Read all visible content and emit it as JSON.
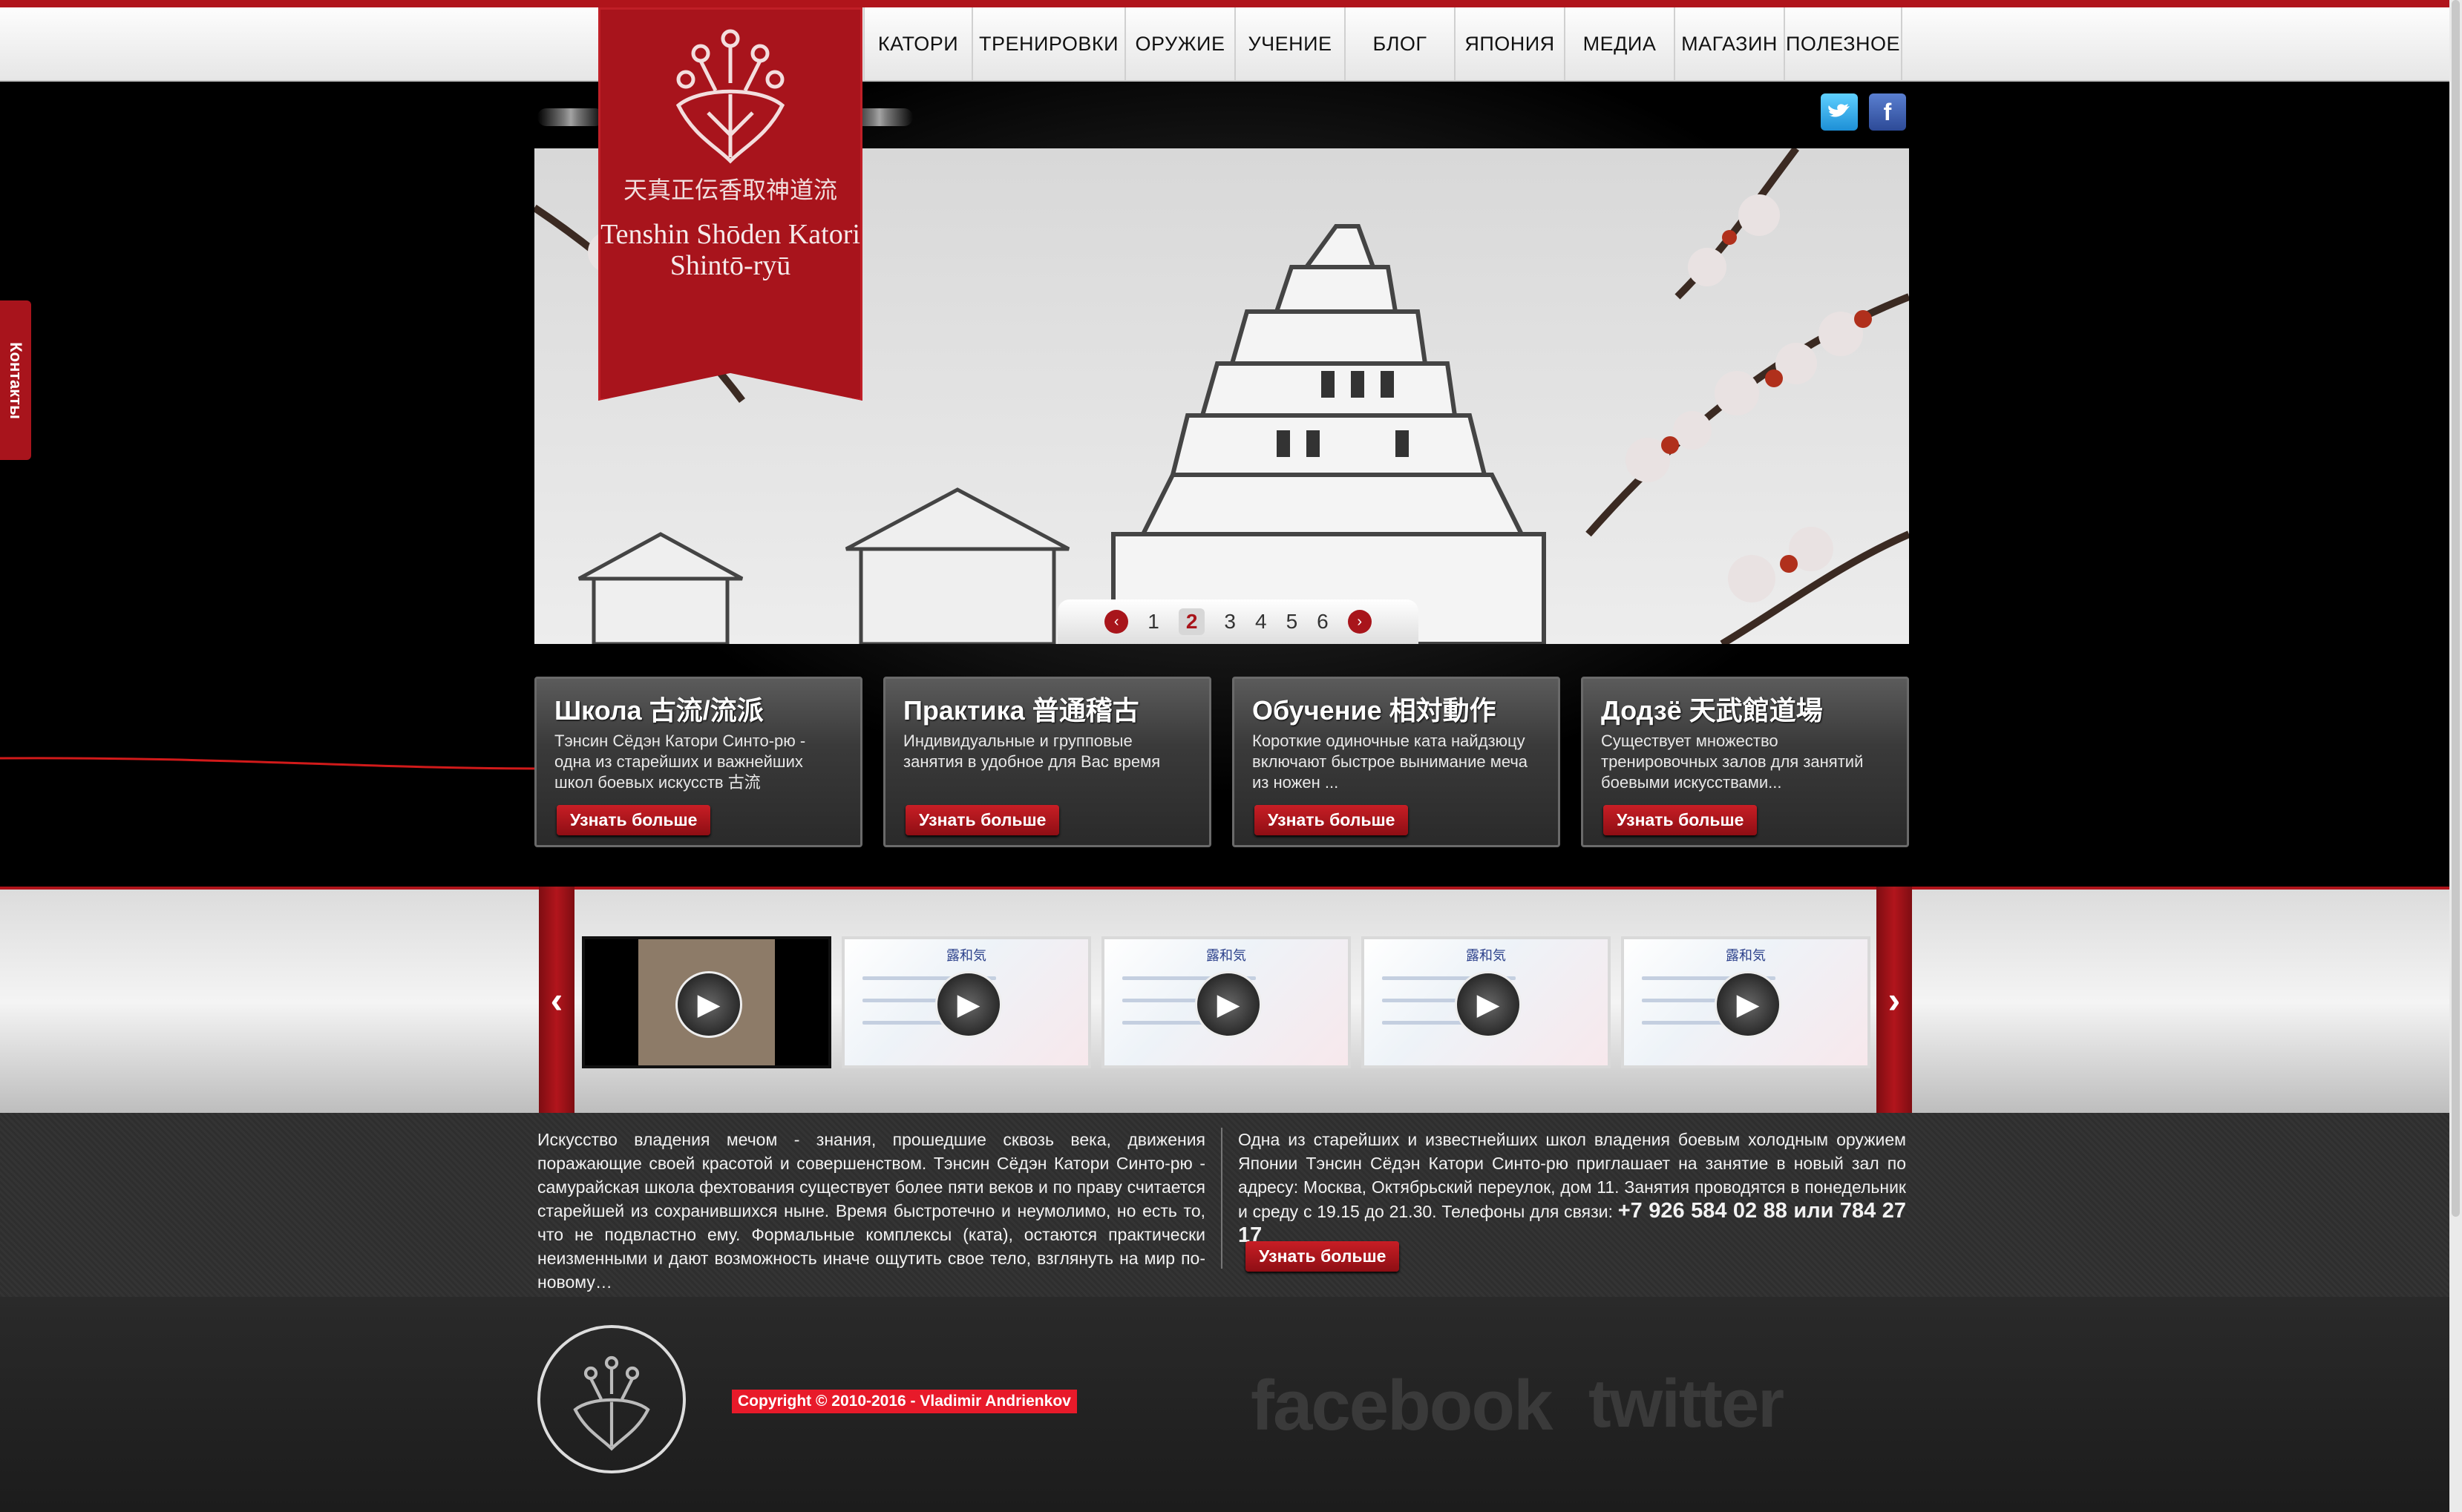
{
  "nav": {
    "items": [
      "КАТОРИ",
      "ТРЕНИРОВКИ",
      "ОРУЖИЕ",
      "УЧЕНИЕ",
      "БЛОГ",
      "ЯПОНИЯ",
      "МЕДИА",
      "МАГАЗИН",
      "ПОЛЕЗНОЕ"
    ]
  },
  "brand": {
    "kanji": "天真正伝香取神道流",
    "name_line1": "Tenshin Shōden Katori",
    "name_line2": "Shintō-ryū"
  },
  "social": {
    "twitter_icon": "twitter-icon",
    "facebook_icon": "facebook-icon"
  },
  "slider": {
    "pages": [
      "1",
      "2",
      "3",
      "4",
      "5",
      "6"
    ],
    "active_page": "2"
  },
  "contacts_tab": "Контакты",
  "cards": [
    {
      "title": "Школа 古流/流派",
      "text": "Тэнсин Сёдэн Катори Синто-рю - одна из старейших и важнейших школ боевых искусств 古流",
      "button": "Узнать больше"
    },
    {
      "title": "Практика 普通稽古",
      "text": "Индивидуальные и групповые занятия в удобное для Вас время",
      "button": "Узнать больше"
    },
    {
      "title": "Обучение 相対動作",
      "text": "Короткие одиночные ката найдзюцу включают быстрое вынимание меча из ножен ...",
      "button": "Узнать больше"
    },
    {
      "title": "Додзё 天武館道場",
      "text": "Существует множество тренировочных залов для занятий боевыми искусствами...",
      "button": "Узнать больше"
    }
  ],
  "videos": {
    "prev": "‹",
    "next": "›",
    "thumb_header": "露和気"
  },
  "about": {
    "left": "Искусство владения мечом - знания, прошедшие сквозь века, движения поражающие своей красотой и совершенством. Тэнсин Сёдэн Катори Синто-рю - самурайская школа фехтования существует более пяти веков и по праву считается старейшей из сохранившихся ныне. Время быстротечно и неумолимо, но есть то, что не подвластно ему. Формальные комплексы (ката), остаются практически неизменными и дают возможность иначе ощутить свое тело, взглянуть на мир по-новому…",
    "right": "Одна из старейших и известнейших школ владения боевым холодным оружием Японии Тэнсин Сёдэн Катори Синто-рю приглашает на занятие в новый зал по адресу: Москва, Октябрьский переулок, дом 11. Занятия проводятся в понедельник и среду с 19.15 до 21.30. Телефоны для связи:",
    "phone": "+7 926 584 02 88 или 784 27 17",
    "button": "Узнать больше"
  },
  "footer": {
    "copyright": "Copyright © 2010-2016 - Vladimir Andrienkov",
    "facebook": "facebook",
    "twitter": "twitter"
  },
  "colors": {
    "accent": "#a8141c",
    "dark": "#0a0a0a"
  }
}
